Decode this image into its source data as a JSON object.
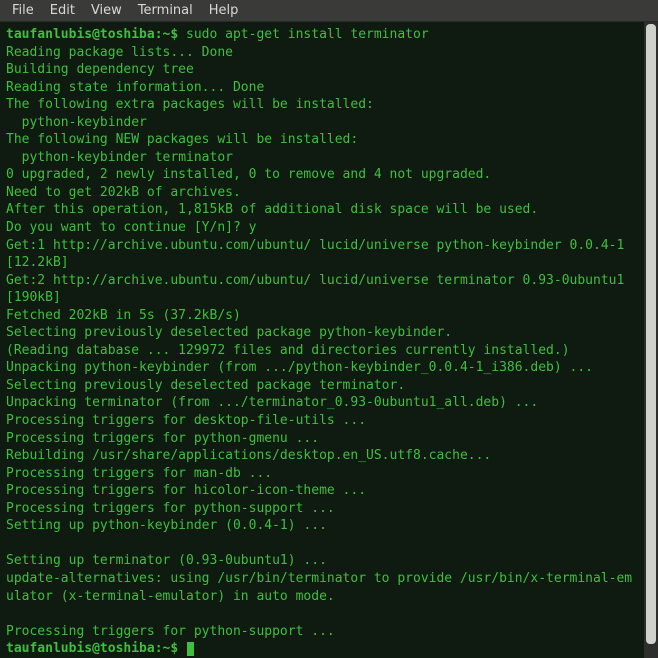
{
  "menubar": {
    "items": [
      "File",
      "Edit",
      "View",
      "Terminal",
      "Help"
    ]
  },
  "terminal": {
    "prompt": "taufanlubis@toshiba:~$ ",
    "command": "sudo apt-get install terminator",
    "user_input": "y",
    "lines": [
      "Reading package lists... Done",
      "Building dependency tree",
      "Reading state information... Done",
      "The following extra packages will be installed:",
      "  python-keybinder",
      "The following NEW packages will be installed:",
      "  python-keybinder terminator",
      "0 upgraded, 2 newly installed, 0 to remove and 4 not upgraded.",
      "Need to get 202kB of archives.",
      "After this operation, 1,815kB of additional disk space will be used.",
      "Do you want to continue [Y/n]? y",
      "Get:1 http://archive.ubuntu.com/ubuntu/ lucid/universe python-keybinder 0.0.4-1 [12.2kB]",
      "Get:2 http://archive.ubuntu.com/ubuntu/ lucid/universe terminator 0.93-0ubuntu1 [190kB]",
      "Fetched 202kB in 5s (37.2kB/s)",
      "Selecting previously deselected package python-keybinder.",
      "(Reading database ... 129972 files and directories currently installed.)",
      "Unpacking python-keybinder (from .../python-keybinder_0.0.4-1_i386.deb) ...",
      "Selecting previously deselected package terminator.",
      "Unpacking terminator (from .../terminator_0.93-0ubuntu1_all.deb) ...",
      "Processing triggers for desktop-file-utils ...",
      "Processing triggers for python-gmenu ...",
      "Rebuilding /usr/share/applications/desktop.en_US.utf8.cache...",
      "Processing triggers for man-db ...",
      "Processing triggers for hicolor-icon-theme ...",
      "Processing triggers for python-support ...",
      "Setting up python-keybinder (0.0.4-1) ...",
      "",
      "Setting up terminator (0.93-0ubuntu1) ...",
      "update-alternatives: using /usr/bin/terminator to provide /usr/bin/x-terminal-emulator (x-terminal-emulator) in auto mode.",
      "",
      "Processing triggers for python-support ..."
    ]
  }
}
